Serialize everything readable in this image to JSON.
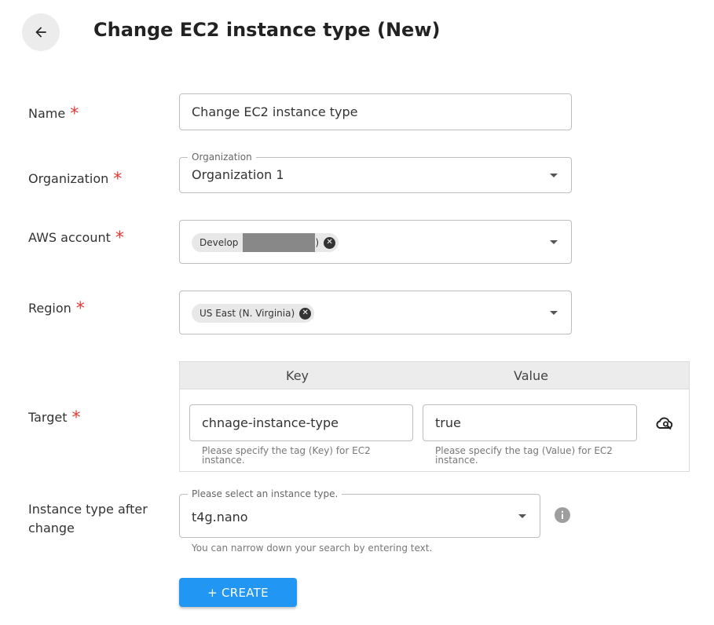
{
  "header": {
    "title": "Change EC2 instance type (New)",
    "back_icon": "arrow-left-icon"
  },
  "form": {
    "required_mark": "*",
    "name": {
      "label": "Name",
      "value": "Change EC2 instance type"
    },
    "organization": {
      "label": "Organization",
      "legend": "Organization",
      "value": "Organization 1"
    },
    "aws_account": {
      "label": "AWS account",
      "chip_label": "Develop",
      "chip_suffix": ")"
    },
    "region": {
      "label": "Region",
      "chip_label": "US East (N. Virginia)"
    },
    "target": {
      "label": "Target",
      "key_header": "Key",
      "value_header": "Value",
      "key_value": "chnage-instance-type",
      "value_value": "true",
      "key_helper": "Please specify the tag (Key) for EC2 instance.",
      "value_helper": "Please specify the tag (Value) for EC2 instance.",
      "action_icon": "cloud-search-icon"
    },
    "instance_type": {
      "label": "Instance type after change",
      "legend": "Please select an instance type.",
      "value": "t4g.nano",
      "helper": "You can narrow down your search by entering text.",
      "info_icon": "info-icon"
    }
  },
  "actions": {
    "create_label": "+ CREATE"
  },
  "colors": {
    "primary": "#2196f3",
    "required": "#e53935"
  }
}
